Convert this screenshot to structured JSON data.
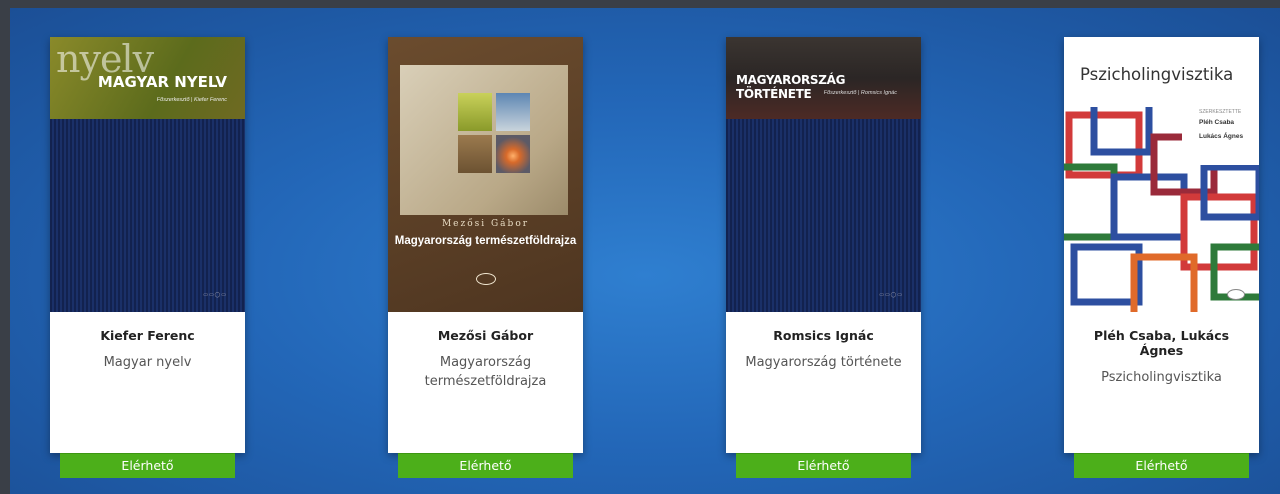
{
  "books": [
    {
      "author": "Kiefer Ferenc",
      "title": "Magyar nyelv",
      "status": "Elérhető",
      "cover": {
        "big_text": "nyelv",
        "title": "MAGYAR NYELV",
        "sub": "Főszerkesztő | Kiefer Ferenc"
      }
    },
    {
      "author": "Mezősi Gábor",
      "title": "Magyarország természetföldrajza",
      "status": "Elérhető",
      "cover": {
        "author": "Mezősi Gábor",
        "title": "Magyarország természetföldrajza"
      }
    },
    {
      "author": "Romsics Ignác",
      "title": "Magyarország története",
      "status": "Elérhető",
      "cover": {
        "title": "MAGYARORSZÁG TÖRTÉNETE",
        "sub": "Főszerkesztő | Romsics Ignác"
      }
    },
    {
      "author": "Pléh Csaba, Lukács Ágnes",
      "title": "Pszicholingvisztika",
      "status": "Elérhető",
      "cover": {
        "title": "Pszicholingvisztika",
        "editors_label": "SZERKESZTETTE",
        "editor1": "Pléh Csaba",
        "editor2": "Lukács Ágnes"
      }
    }
  ],
  "colors": {
    "status_green": "#4caf1a",
    "background_blue": "#2367b8"
  }
}
